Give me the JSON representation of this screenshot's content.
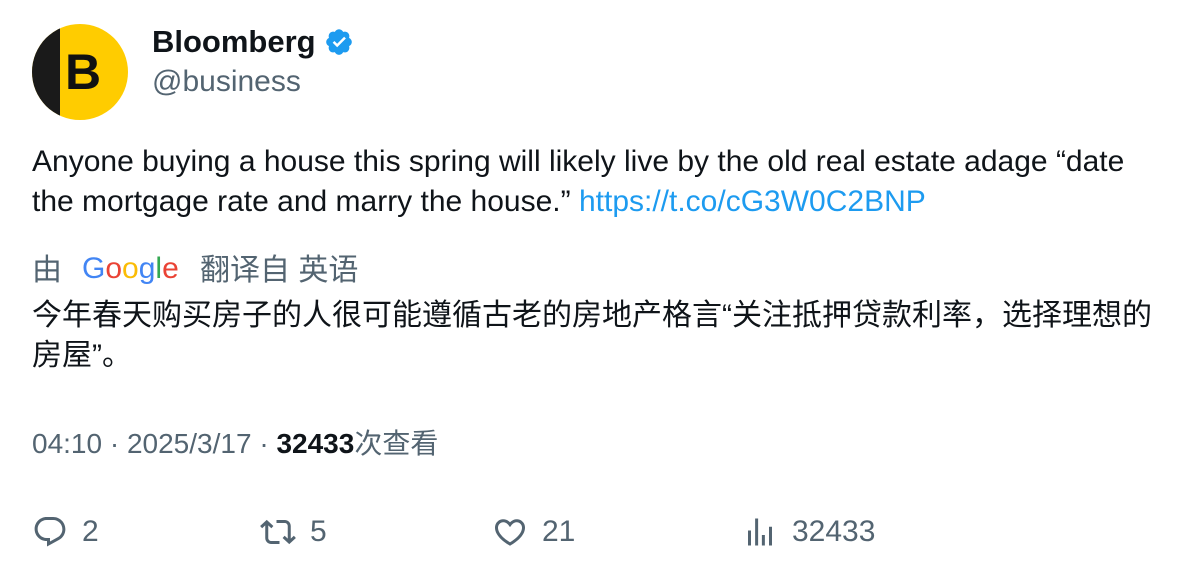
{
  "author": {
    "display_name": "Bloomberg",
    "handle": "@business",
    "avatar_letter": "B",
    "verified": true,
    "verified_icon": "verified-badge-icon",
    "avatar_colors": {
      "yellow": "#ffcc00",
      "dark": "#1a1a1a"
    }
  },
  "tweet": {
    "text": "Anyone buying a house this spring will likely live by the old real estate adage “date the mortgage rate and marry the house.” ",
    "link": "https://t.co/cG3W0C2BNP"
  },
  "translation": {
    "by": "由",
    "provider": "Google",
    "provider_icon": "google-logo-icon",
    "from_label": "翻译自 英语",
    "text": "今年春天购买房子的人很可能遵循古老的房地产格言“关注抵押贷款利率，选择理想的房屋”。"
  },
  "meta": {
    "time": "04:10",
    "separator1": " · ",
    "date": "2025/3/17",
    "separator2": " · ",
    "views": "32433",
    "views_label": "次查看"
  },
  "actions": {
    "reply_count": "2",
    "retweet_count": "5",
    "like_count": "21",
    "views_count": "32433",
    "icons": [
      "reply-icon",
      "retweet-icon",
      "like-icon",
      "views-icon"
    ]
  },
  "colors": {
    "text_primary": "#0f1419",
    "text_secondary": "#536471",
    "link": "#1d9bf0",
    "verified": "#1d9bf0"
  }
}
